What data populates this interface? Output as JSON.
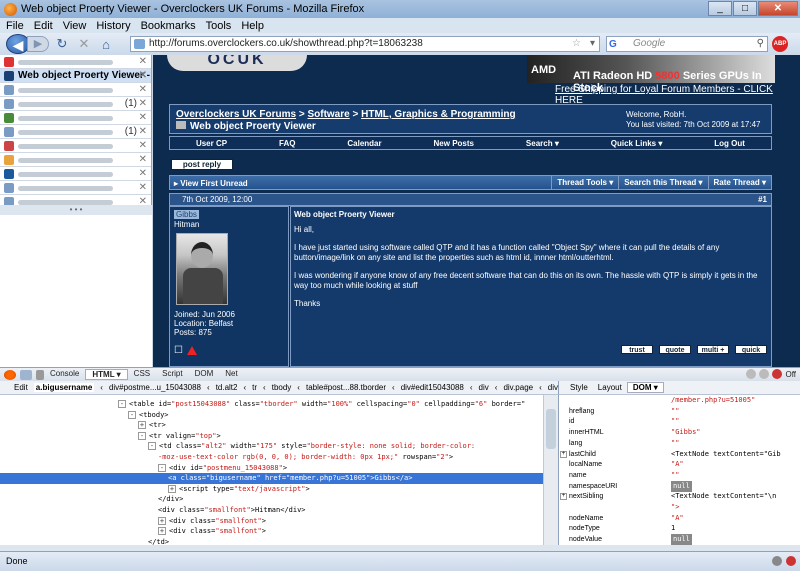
{
  "window": {
    "title": "Web object Proerty Viewer - Overclockers UK Forums - Mozilla Firefox"
  },
  "menu": [
    "File",
    "Edit",
    "View",
    "History",
    "Bookmarks",
    "Tools",
    "Help"
  ],
  "nav": {
    "url": "http://forums.overclockers.co.uk/showthread.php?t=18063238",
    "search_placeholder": "Google",
    "abp": "ABP"
  },
  "tabs": [
    {
      "label": "",
      "color": "#d33",
      "blur": true
    },
    {
      "label": "Web object Proerty Viewer - ...",
      "color": "#1a3f73",
      "blur": false,
      "active": true
    },
    {
      "label": "",
      "color": "#7a9cc4",
      "blur": true
    },
    {
      "label": "",
      "color": "#7a9cc4",
      "blur": true,
      "count": "(1)"
    },
    {
      "label": "",
      "color": "#4a8b3a",
      "blur": true
    },
    {
      "label": "",
      "color": "#7a9cc4",
      "blur": true,
      "count": "(1)"
    },
    {
      "label": "",
      "color": "#c44",
      "blur": true
    },
    {
      "label": "",
      "color": "#e8a33c",
      "blur": true
    },
    {
      "label": "",
      "color": "#1a5a9c",
      "blur": true
    },
    {
      "label": "",
      "color": "#7a9cc4",
      "blur": true
    },
    {
      "label": "",
      "color": "#7a9cc4",
      "blur": true
    }
  ],
  "forum": {
    "logo": "OCUK",
    "banner": {
      "brand": "AMD",
      "tagline": "ATI Radeon HD ",
      "model": "5800",
      "tail": " Series GPUs In Stock"
    },
    "shipping": "Free Shipping for Loyal Forum Members - CLICK HERE",
    "breadcrumb": [
      "Overclockers UK Forums",
      "Software",
      "HTML, Graphics & Programming"
    ],
    "thread_title": "Web object Proerty Viewer",
    "welcome": "Welcome, RobH.",
    "last_visit": "You last visited: 7th Oct 2009 at 17:47",
    "navlinks": [
      "User CP",
      "FAQ",
      "Calendar",
      "New Posts",
      "Search",
      "Quick Links",
      "Log Out"
    ],
    "post_reply": "post reply",
    "view_first_unread": "View First Unread",
    "thread_tools": [
      "Thread Tools",
      "Search this Thread",
      "Rate Thread"
    ],
    "post_date": "7th Oct 2009, 12:00",
    "post_no": "#1",
    "user": {
      "name": "Gibbs",
      "title": "Hitman",
      "joined": "Joined: Jun 2006",
      "location": "Location: Belfast",
      "posts": "Posts: 875"
    },
    "post": {
      "title": "Web object Proerty Viewer",
      "paragraphs": [
        "Hi all,",
        "I have just started using software called QTP and it has a function called \"Object Spy\" where it can pull the details of any button/image/link on any site and list the properties such as html id, innner html/outterhtml.",
        "I was wondering if anyone know of any free decent software that can do this on its own. The hassle with QTP is simply it gets in the way too much while looking at stuff",
        "Thanks"
      ],
      "buttons": [
        "trust",
        "quote",
        "multi +",
        "quick"
      ]
    }
  },
  "firebug": {
    "tabs": [
      "Console",
      "HTML",
      "CSS",
      "Script",
      "DOM",
      "Net"
    ],
    "active_tab": "HTML",
    "off": "Off",
    "crumbs": [
      "Edit",
      "a.bigusername",
      "div#postme...u_15043088",
      "td.alt2",
      "tr",
      "tbody",
      "table#post...88.tborder",
      "div#edit15043088",
      "div",
      "div.page",
      "div"
    ],
    "side_tabs": [
      "Style",
      "Layout",
      "DOM"
    ],
    "html_lines": [
      {
        "indent": 0,
        "pm": "-",
        "parts": [
          [
            "t",
            "<table "
          ],
          [
            "at",
            "id"
          ],
          [
            "t",
            "="
          ],
          [
            "v",
            "\"post15043088\""
          ],
          [
            "t",
            " "
          ],
          [
            "at",
            "class"
          ],
          [
            "t",
            "="
          ],
          [
            "v",
            "\"tborder\""
          ],
          [
            "t",
            " "
          ],
          [
            "at",
            "width"
          ],
          [
            "t",
            "="
          ],
          [
            "v",
            "\"100%\""
          ],
          [
            "t",
            " "
          ],
          [
            "at",
            "cellspacing"
          ],
          [
            "t",
            "="
          ],
          [
            "v",
            "\"0\""
          ],
          [
            "t",
            " "
          ],
          [
            "at",
            "cellpadding"
          ],
          [
            "t",
            "="
          ],
          [
            "v",
            "\"6\""
          ],
          [
            "t",
            " "
          ],
          [
            "at",
            "border"
          ],
          [
            "t",
            "=\""
          ]
        ]
      },
      {
        "indent": 1,
        "pm": "-",
        "parts": [
          [
            "t",
            "<tbody>"
          ]
        ]
      },
      {
        "indent": 2,
        "pm": "+",
        "parts": [
          [
            "t",
            "<tr>"
          ]
        ]
      },
      {
        "indent": 2,
        "pm": "-",
        "parts": [
          [
            "t",
            "<tr "
          ],
          [
            "at",
            "valign"
          ],
          [
            "t",
            "="
          ],
          [
            "v",
            "\"top\""
          ],
          [
            "t",
            ">"
          ]
        ]
      },
      {
        "indent": 3,
        "pm": "-",
        "parts": [
          [
            "t",
            "<td "
          ],
          [
            "at",
            "class"
          ],
          [
            "t",
            "="
          ],
          [
            "v",
            "\"alt2\""
          ],
          [
            "t",
            " "
          ],
          [
            "at",
            "width"
          ],
          [
            "t",
            "="
          ],
          [
            "v",
            "\"175\""
          ],
          [
            "t",
            " "
          ],
          [
            "at",
            "style"
          ],
          [
            "t",
            "="
          ],
          [
            "v",
            "\"border-style: none solid; border-color:"
          ]
        ]
      },
      {
        "indent": 4,
        "pm": "",
        "parts": [
          [
            "v",
            "-moz-use-text-color rgb(0, 0, 0); border-width: 0px 1px;\""
          ],
          [
            "t",
            " "
          ],
          [
            "at",
            "rowspan"
          ],
          [
            "t",
            "="
          ],
          [
            "v",
            "\"2\""
          ],
          [
            "t",
            ">"
          ]
        ]
      },
      {
        "indent": 4,
        "pm": "-",
        "parts": [
          [
            "t",
            "<div "
          ],
          [
            "at",
            "id"
          ],
          [
            "t",
            "="
          ],
          [
            "v",
            "\"postmenu_15043088\""
          ],
          [
            "t",
            ">"
          ]
        ]
      },
      {
        "indent": 5,
        "pm": "",
        "sel": true,
        "parts": [
          [
            "t",
            "<a "
          ],
          [
            "at",
            "class"
          ],
          [
            "t",
            "="
          ],
          [
            "v",
            "\"bigusername\""
          ],
          [
            "t",
            " "
          ],
          [
            "at",
            "href"
          ],
          [
            "t",
            "="
          ],
          [
            "v",
            "\"member.php?u=51005\""
          ],
          [
            "t",
            ">Gibbs</a>"
          ]
        ]
      },
      {
        "indent": 5,
        "pm": "+",
        "parts": [
          [
            "t",
            "<script "
          ],
          [
            "at",
            "type"
          ],
          [
            "t",
            "="
          ],
          [
            "v",
            "\"text/javascript\""
          ],
          [
            "t",
            ">"
          ]
        ]
      },
      {
        "indent": 4,
        "pm": "",
        "parts": [
          [
            "t",
            "</div>"
          ]
        ]
      },
      {
        "indent": 4,
        "pm": "",
        "parts": [
          [
            "t",
            "<div "
          ],
          [
            "at",
            "class"
          ],
          [
            "t",
            "="
          ],
          [
            "v",
            "\"smallfont\""
          ],
          [
            "t",
            ">Hitman</div>"
          ]
        ]
      },
      {
        "indent": 4,
        "pm": "+",
        "parts": [
          [
            "t",
            "<div "
          ],
          [
            "at",
            "class"
          ],
          [
            "t",
            "="
          ],
          [
            "v",
            "\"smallfont\""
          ],
          [
            "t",
            ">"
          ]
        ]
      },
      {
        "indent": 4,
        "pm": "+",
        "parts": [
          [
            "t",
            "<div "
          ],
          [
            "at",
            "class"
          ],
          [
            "t",
            "="
          ],
          [
            "v",
            "\"smallfont\""
          ],
          [
            "t",
            ">"
          ]
        ]
      },
      {
        "indent": 3,
        "pm": "",
        "parts": [
          [
            "t",
            "</td>"
          ]
        ]
      }
    ],
    "dom_rows": [
      {
        "k": "",
        "v": "/member.php?u=51005\"",
        "cls": ""
      },
      {
        "k": "hreflang",
        "v": "\"\"",
        "cls": ""
      },
      {
        "k": "id",
        "v": "\"\"",
        "cls": ""
      },
      {
        "k": "innerHTML",
        "v": "\"Gibbs\"",
        "cls": ""
      },
      {
        "k": "lang",
        "v": "\"\"",
        "cls": ""
      },
      {
        "k": "lastChild",
        "v": "<TextNode textContent=\"Gib",
        "cls": "obj",
        "pm": "+"
      },
      {
        "k": "localName",
        "v": "\"A\"",
        "cls": ""
      },
      {
        "k": "name",
        "v": "\"\"",
        "cls": ""
      },
      {
        "k": "namespaceURI",
        "v": "null",
        "cls": "null"
      },
      {
        "k": "nextSibling",
        "v": "<TextNode textContent=\"\\n",
        "cls": "obj",
        "pm": "+"
      },
      {
        "k": "",
        "v": "\">",
        "cls": ""
      },
      {
        "k": "nodeName",
        "v": "\"A\"",
        "cls": ""
      },
      {
        "k": "nodeType",
        "v": "1",
        "cls": "obj"
      },
      {
        "k": "nodeValue",
        "v": "null",
        "cls": "null"
      }
    ]
  },
  "status": "Done"
}
